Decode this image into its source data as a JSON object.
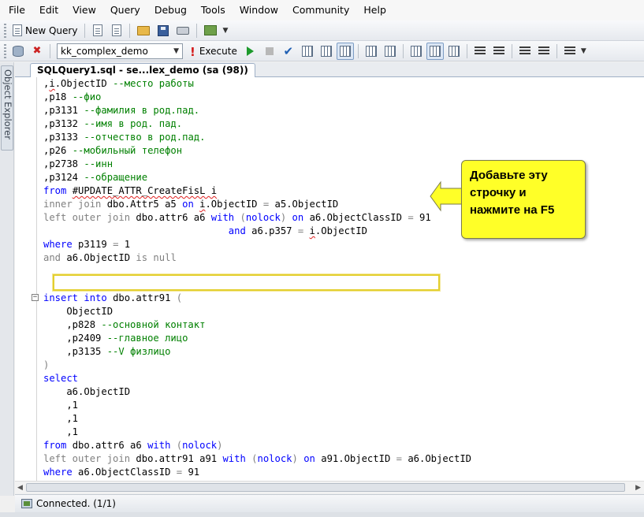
{
  "menu": [
    "File",
    "Edit",
    "View",
    "Query",
    "Debug",
    "Tools",
    "Window",
    "Community",
    "Help"
  ],
  "toolbar": {
    "new_query_label": "New Query",
    "database": "kk_complex_demo",
    "execute_label": "Execute"
  },
  "sidebar": {
    "object_explorer_label": "Object Explorer"
  },
  "document_tab": {
    "title": "SQLQuery1.sql - se...lex_demo (sa (98))"
  },
  "code_lines": [
    [
      {
        "c": "black",
        "t": "\t,"
      },
      {
        "c": "black",
        "t": "i",
        "s": true
      },
      {
        "c": "black",
        "t": ".ObjectID "
      },
      {
        "c": "green",
        "t": "--место работы"
      }
    ],
    [
      {
        "c": "black",
        "t": "\t,p18 "
      },
      {
        "c": "green",
        "t": "--фио"
      }
    ],
    [
      {
        "c": "black",
        "t": "\t,p3131 "
      },
      {
        "c": "green",
        "t": "--фамилия в род.пад."
      }
    ],
    [
      {
        "c": "black",
        "t": "\t,p3132 "
      },
      {
        "c": "green",
        "t": "--имя в род. пад."
      }
    ],
    [
      {
        "c": "black",
        "t": "\t,p3133 "
      },
      {
        "c": "green",
        "t": "--отчество в род.пад."
      }
    ],
    [
      {
        "c": "black",
        "t": "\t,p26 "
      },
      {
        "c": "green",
        "t": "--мобильный телефон"
      }
    ],
    [
      {
        "c": "black",
        "t": "\t,p2738 "
      },
      {
        "c": "green",
        "t": "--инн"
      }
    ],
    [
      {
        "c": "black",
        "t": "\t,p3124 "
      },
      {
        "c": "green",
        "t": "--обращение"
      }
    ],
    [
      {
        "c": "kw",
        "t": "\tfrom "
      },
      {
        "c": "black",
        "t": "#UPDATE_ATTR_CreateFisL i",
        "s": true
      }
    ],
    [
      {
        "c": "gray",
        "t": "\tinner join "
      },
      {
        "c": "black",
        "t": "dbo.Attr5 a5 "
      },
      {
        "c": "kw",
        "t": "on "
      },
      {
        "c": "black",
        "t": "i",
        "s": true
      },
      {
        "c": "black",
        "t": ".ObjectID "
      },
      {
        "c": "gray",
        "t": "= "
      },
      {
        "c": "black",
        "t": "a5.ObjectID"
      }
    ],
    [
      {
        "c": "gray",
        "t": "\tleft outer join "
      },
      {
        "c": "black",
        "t": "dbo.attr6 a6 "
      },
      {
        "c": "kw",
        "t": "with "
      },
      {
        "c": "gray",
        "t": "("
      },
      {
        "c": "kw",
        "t": "nolock"
      },
      {
        "c": "gray",
        "t": ") "
      },
      {
        "c": "kw",
        "t": "on "
      },
      {
        "c": "black",
        "t": "a6.ObjectClassID "
      },
      {
        "c": "gray",
        "t": "= "
      },
      {
        "c": "black",
        "t": "91"
      }
    ],
    [
      {
        "c": "black",
        "t": "\t\t\t\t\t\t\t\t\t\t\t\t\t\t\t\t\t\t\t\t\t\t\t\t\t\t\t\t\t\t\t\t\t\t\t\t\t\t\t\t\t\t\t\t"
      }
    ],
    [
      {
        "c": "kw",
        "t": "\twhere "
      },
      {
        "c": "black",
        "t": "p3119 "
      },
      {
        "c": "gray",
        "t": "= "
      },
      {
        "c": "black",
        "t": "1"
      }
    ],
    [
      {
        "c": "gray",
        "t": "\tand "
      },
      {
        "c": "black",
        "t": "a6.ObjectID "
      },
      {
        "c": "gray",
        "t": "is null"
      }
    ],
    [],
    [],
    [
      {
        "c": "kw",
        "t": "\tinsert into "
      },
      {
        "c": "black",
        "t": "dbo.attr91 "
      },
      {
        "c": "gray",
        "t": "("
      }
    ],
    [
      {
        "c": "black",
        "t": "\t\tObjectID"
      }
    ],
    [
      {
        "c": "black",
        "t": "\t\t,p828 "
      },
      {
        "c": "green",
        "t": "--основной контакт"
      }
    ],
    [
      {
        "c": "black",
        "t": "\t\t,p2409 "
      },
      {
        "c": "green",
        "t": "--главное лицо"
      }
    ],
    [
      {
        "c": "black",
        "t": "\t\t,p3135 "
      },
      {
        "c": "green",
        "t": "--V физлицо"
      }
    ],
    [
      {
        "c": "gray",
        "t": "\t)"
      }
    ],
    [
      {
        "c": "kw",
        "t": "\tselect"
      }
    ],
    [
      {
        "c": "black",
        "t": "\t\ta6.ObjectID"
      }
    ],
    [
      {
        "c": "black",
        "t": "\t\t,1"
      }
    ],
    [
      {
        "c": "black",
        "t": "\t\t,1"
      }
    ],
    [
      {
        "c": "black",
        "t": "\t\t,1"
      }
    ],
    [
      {
        "c": "kw",
        "t": "\tfrom "
      },
      {
        "c": "black",
        "t": "dbo.attr6 a6 "
      },
      {
        "c": "kw",
        "t": "with "
      },
      {
        "c": "gray",
        "t": "("
      },
      {
        "c": "kw",
        "t": "nolock"
      },
      {
        "c": "gray",
        "t": ")"
      }
    ],
    [
      {
        "c": "gray",
        "t": "\tleft outer join "
      },
      {
        "c": "black",
        "t": "dbo.attr91 a91 "
      },
      {
        "c": "kw",
        "t": "with "
      },
      {
        "c": "gray",
        "t": "("
      },
      {
        "c": "kw",
        "t": "nolock"
      },
      {
        "c": "gray",
        "t": ") "
      },
      {
        "c": "kw",
        "t": "on "
      },
      {
        "c": "black",
        "t": "a91.ObjectID "
      },
      {
        "c": "gray",
        "t": "= "
      },
      {
        "c": "black",
        "t": "a6.ObjectID"
      }
    ],
    [
      {
        "c": "kw",
        "t": "\twhere "
      },
      {
        "c": "black",
        "t": "a6.ObjectClassID "
      },
      {
        "c": "gray",
        "t": "= "
      },
      {
        "c": "black",
        "t": "91"
      }
    ]
  ],
  "continuation_line": {
    "and_kw": "and ",
    "field": "a6.p357 ",
    "eq": "= ",
    "alias": "i",
    "rest": ".ObjectID"
  },
  "callout": {
    "text_lines": [
      "Добавьте эту",
      "строчку и",
      "нажмите на F5"
    ]
  },
  "status": {
    "text": "Connected. (1/1)"
  },
  "colors": {
    "keyword": "#0000ff",
    "operator": "#808080",
    "comment": "#008000",
    "callout_fill": "#ffff28",
    "highlight_border": "#e3cf2f"
  },
  "icons": {
    "new_query": "new-query-icon",
    "execute": "execute-icon",
    "parse": "check-icon",
    "stop": "stop-icon"
  }
}
